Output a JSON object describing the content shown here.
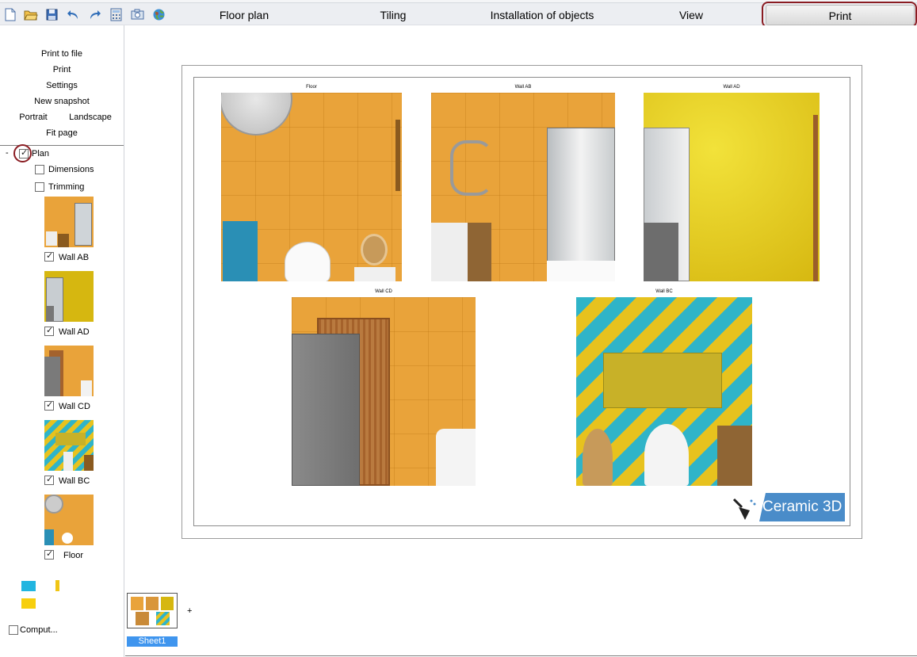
{
  "toolbar": {
    "icons": [
      "new-file-icon",
      "open-folder-icon",
      "save-icon",
      "undo-icon",
      "redo-icon",
      "calculator-icon",
      "camera-icon",
      "globe-icon"
    ]
  },
  "tabs": [
    {
      "label": "Floor plan"
    },
    {
      "label": "Tiling"
    },
    {
      "label": "Installation of objects"
    },
    {
      "label": "View"
    },
    {
      "label": "Print"
    }
  ],
  "print_menu": {
    "print_to_file": "Print to file",
    "print": "Print",
    "settings": "Settings",
    "new_snapshot": "New snapshot",
    "portrait": "Portrait",
    "landscape": "Landscape",
    "fit_page": "Fit page"
  },
  "tree": {
    "collapse": "-",
    "plan": {
      "label": "Plan",
      "checked": true
    },
    "dimensions": {
      "label": "Dimensions",
      "checked": false
    },
    "trimming": {
      "label": "Trimming",
      "checked": false
    },
    "views": [
      {
        "label": "Wall AB",
        "checked": true
      },
      {
        "label": "Wall AD",
        "checked": true
      },
      {
        "label": "Wall CD",
        "checked": true
      },
      {
        "label": "Wall BC",
        "checked": true
      },
      {
        "label": "Floor",
        "checked": true
      }
    ],
    "computed": {
      "label": "Comput...",
      "checked": false
    }
  },
  "sheet": {
    "views": [
      {
        "title": "Floor"
      },
      {
        "title": "Wall AB"
      },
      {
        "title": "Wall AD"
      },
      {
        "title": "Wall CD"
      },
      {
        "title": "Wall BC"
      }
    ],
    "logo_text": "Ceramic 3D"
  },
  "sheets_bar": {
    "tab_label": "Sheet1",
    "add_label": "+"
  },
  "colors": {
    "accent_ring": "#8a1c22",
    "selected_tab": "#3f95ee",
    "logo_bg": "#4a8cc9"
  }
}
